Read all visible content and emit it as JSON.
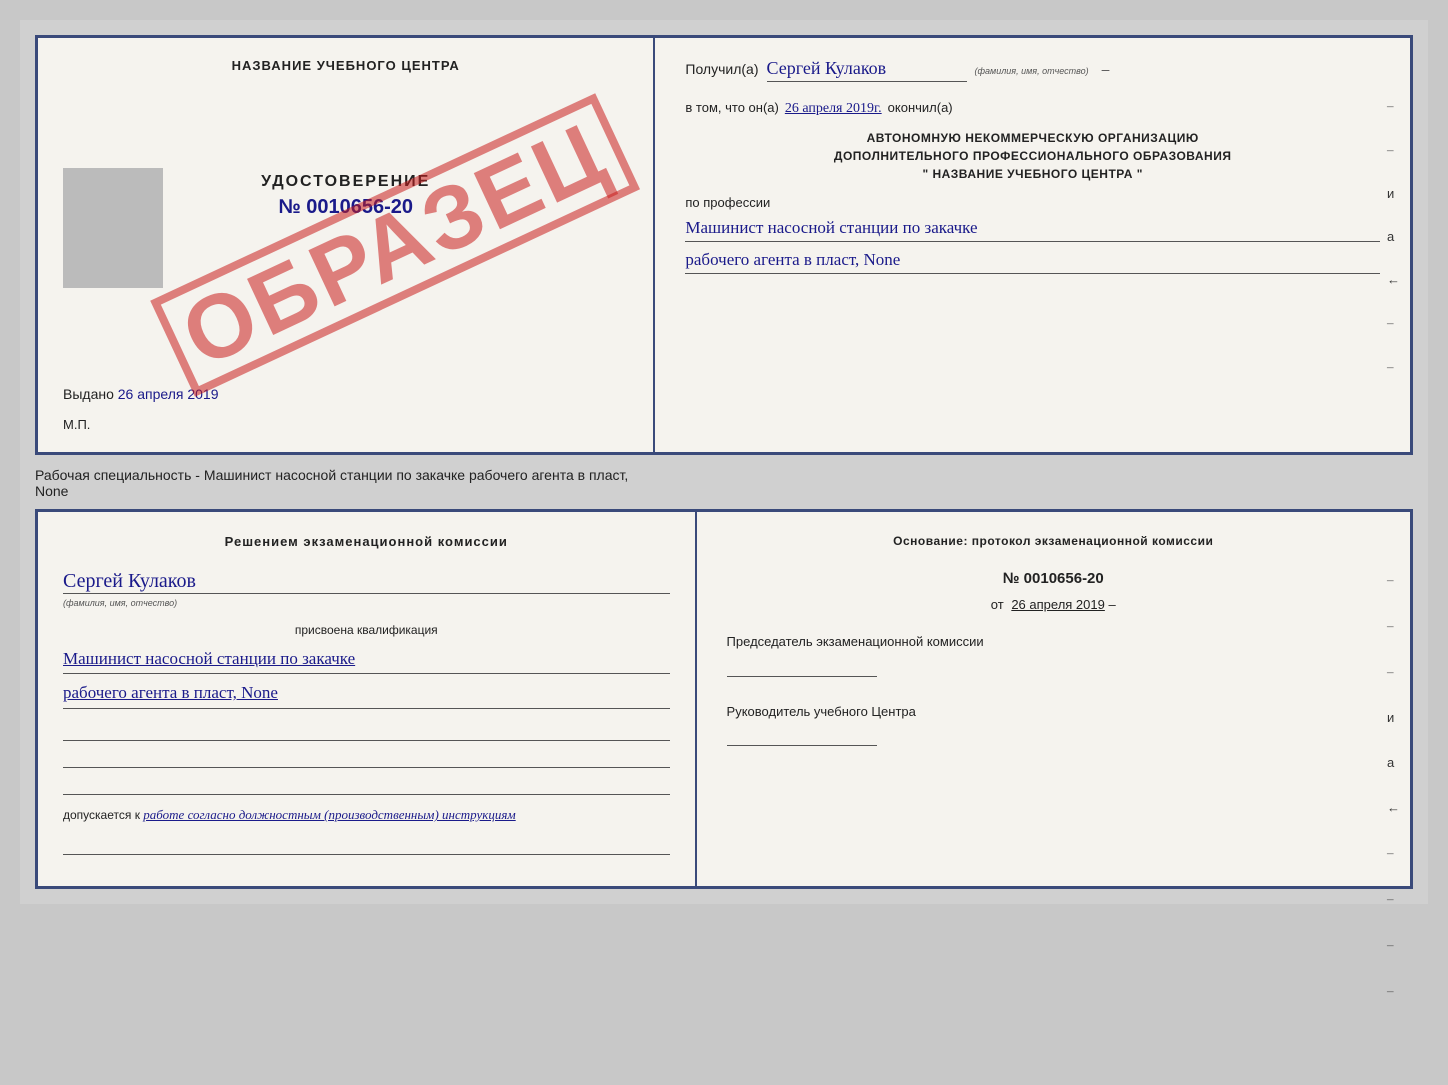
{
  "top_cert": {
    "left": {
      "title": "НАЗВАНИЕ УЧЕБНОГО ЦЕНТРА",
      "udostoverenie_label": "УДОСТОВЕРЕНИЕ",
      "number": "№ 0010656-20",
      "stamp": "ОБРАЗЕЦ",
      "vydano_label": "Выдано",
      "vydano_date": "26 апреля 2019",
      "mp_label": "М.П."
    },
    "right": {
      "poluchil_label": "Получил(а)",
      "recipient_name": "Сергей Кулаков",
      "name_hint": "(фамилия, имя, отчество)",
      "vtom_label": "в том, что он(а)",
      "date": "26 апреля 2019г.",
      "okoncil_label": "окончил(а)",
      "org_line1": "АВТОНОМНУЮ НЕКОММЕРЧЕСКУЮ ОРГАНИЗАЦИЮ",
      "org_line2": "ДОПОЛНИТЕЛЬНОГО ПРОФЕССИОНАЛЬНОГО ОБРАЗОВАНИЯ",
      "org_line3": "\"  НАЗВАНИЕ УЧЕБНОГО ЦЕНТРА  \"",
      "po_professii": "по профессии",
      "prof_line1": "Машинист насосной станции по закачке",
      "prof_line2": "рабочего агента в пласт, None"
    }
  },
  "spec_text": "Рабочая специальность - Машинист насосной станции по закачке рабочего агента в пласт,",
  "spec_text2": "None",
  "bottom_cert": {
    "left": {
      "resheniem_text": "Решением  экзаменационной  комиссии",
      "name": "Сергей Кулаков",
      "name_hint": "(фамилия, имя, отчество)",
      "prisvoena": "присвоена квалификация",
      "qual_line1": "Машинист насосной станции по закачке",
      "qual_line2": "рабочего агента в пласт, None",
      "dopuskaetsya_prefix": "допускается к",
      "dopuskaetsya_italic": "работе согласно должностным (производственным) инструкциям"
    },
    "right": {
      "osnovanie_text": "Основание: протокол экзаменационной  комиссии",
      "protocol_number": "№  0010656-20",
      "ot_label": "от",
      "ot_date": "26 апреля 2019",
      "predsedatel_label": "Председатель экзаменационной комиссии",
      "rukovoditel_label": "Руководитель учебного Центра"
    }
  },
  "side_chars": {
    "i_char": "и",
    "a_char": "а",
    "arrow": "←"
  }
}
